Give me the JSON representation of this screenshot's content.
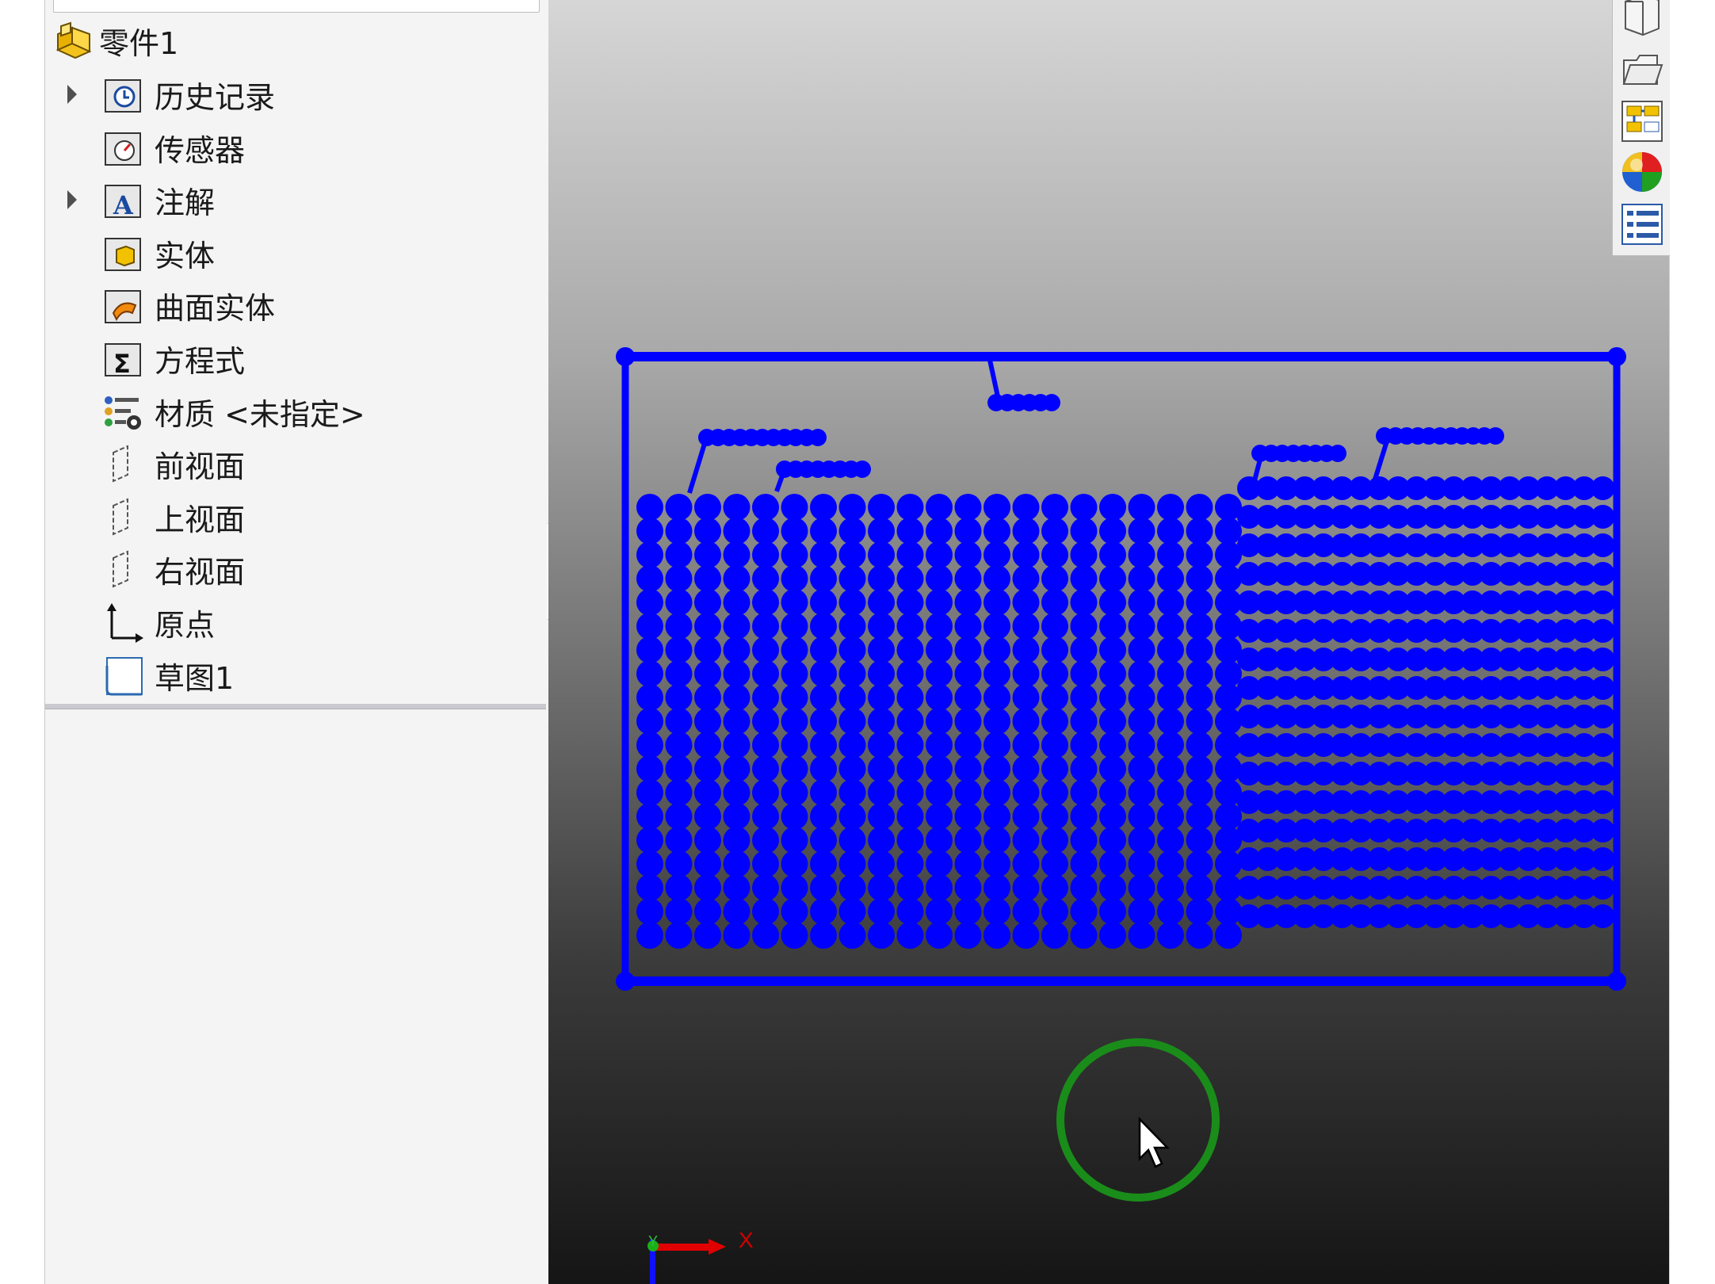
{
  "feature_tree": {
    "root_label": "零件1",
    "items": [
      {
        "label": "历史记录",
        "icon": "history-folder-icon",
        "expandable": true
      },
      {
        "label": "传感器",
        "icon": "sensor-folder-icon",
        "expandable": false
      },
      {
        "label": "注解",
        "icon": "annotation-folder-icon",
        "expandable": true
      },
      {
        "label": "实体",
        "icon": "solid-bodies-folder-icon",
        "expandable": false
      },
      {
        "label": "曲面实体",
        "icon": "surface-bodies-folder-icon",
        "expandable": false
      },
      {
        "label": "方程式",
        "icon": "equations-folder-icon",
        "expandable": false
      },
      {
        "label": "材质 <未指定>",
        "icon": "material-icon",
        "expandable": false
      },
      {
        "label": "前视面",
        "icon": "plane-icon",
        "expandable": false
      },
      {
        "label": "上视面",
        "icon": "plane-icon",
        "expandable": false
      },
      {
        "label": "右视面",
        "icon": "plane-icon",
        "expandable": false
      },
      {
        "label": "原点",
        "icon": "origin-icon",
        "expandable": false
      },
      {
        "label": "草图1",
        "icon": "sketch-icon",
        "expandable": false
      }
    ]
  },
  "viewport": {
    "axis_x_label": "X",
    "axis_y_label": "Y",
    "sketch_color": "#0000ff",
    "cursor_ring_color": "#1a8c1a"
  },
  "task_pane": {
    "buttons": [
      "3d-library-icon",
      "file-explorer-icon",
      "view-palette-icon",
      "appearances-icon",
      "custom-properties-icon"
    ]
  }
}
